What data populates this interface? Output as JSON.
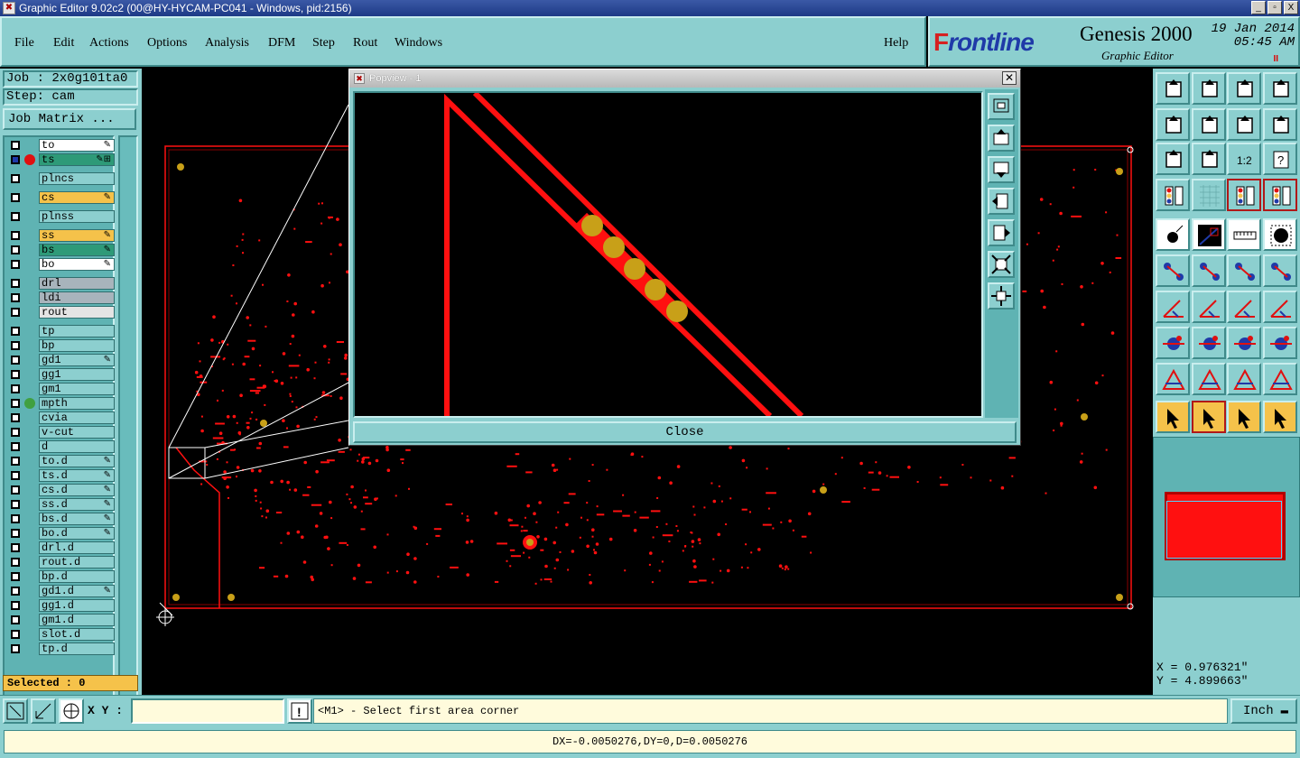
{
  "window": {
    "title": "Graphic Editor 9.02c2 (00@HY-HYCAM-PC041 - Windows, pid:2156)",
    "controls": [
      "_",
      "▫",
      "X"
    ]
  },
  "menu": {
    "items": [
      "File",
      "Edit",
      "Actions",
      "Options",
      "Analysis",
      "DFM",
      "Step",
      "Rout",
      "Windows"
    ],
    "help": "Help"
  },
  "brand": {
    "logo_prefix": "F",
    "logo": "rontline",
    "product": "Genesis 2000",
    "subtitle": "Graphic Editor",
    "date": "19 Jan 2014",
    "time": "05:45 AM",
    "pause": "II"
  },
  "job": {
    "label": "Job : 2x0g101ta0",
    "step": "Step: cam",
    "matrix_button": "Job Matrix ..."
  },
  "layers": [
    {
      "name": "to",
      "color": "#ffffff",
      "mark": "✎"
    },
    {
      "name": "ts",
      "color": "#2e9a78",
      "mark": "✎⊞",
      "work": true,
      "dot": "#e01010"
    },
    {
      "name": "plncs",
      "color": "#8ccfcf",
      "mark": ""
    },
    {
      "name": "cs",
      "color": "#f5c24a",
      "mark": "✎"
    },
    {
      "name": "plnss",
      "color": "#8ccfcf",
      "mark": ""
    },
    {
      "name": "ss",
      "color": "#f5c24a",
      "mark": "✎"
    },
    {
      "name": "bs",
      "color": "#2e9a78",
      "mark": "✎"
    },
    {
      "name": "bo",
      "color": "#ffffff",
      "mark": "✎"
    },
    {
      "name": "drl",
      "color": "#a8b4bc",
      "mark": ""
    },
    {
      "name": "ldi",
      "color": "#a8b4bc",
      "mark": ""
    },
    {
      "name": "rout",
      "color": "#e4e4e4",
      "mark": ""
    },
    {
      "name": "tp",
      "color": "#8ccfcf",
      "mark": ""
    },
    {
      "name": "bp",
      "color": "#8ccfcf",
      "mark": ""
    },
    {
      "name": "gd1",
      "color": "#8ccfcf",
      "mark": "✎"
    },
    {
      "name": "gg1",
      "color": "#8ccfcf",
      "mark": ""
    },
    {
      "name": "gm1",
      "color": "#8ccfcf",
      "mark": ""
    },
    {
      "name": "mpth",
      "color": "#8ccfcf",
      "mark": "",
      "dot": "#40a040"
    },
    {
      "name": "cvia",
      "color": "#8ccfcf",
      "mark": ""
    },
    {
      "name": "v-cut",
      "color": "#8ccfcf",
      "mark": ""
    },
    {
      "name": "d",
      "color": "#8ccfcf",
      "mark": ""
    },
    {
      "name": "to.d",
      "color": "#8ccfcf",
      "mark": "✎"
    },
    {
      "name": "ts.d",
      "color": "#8ccfcf",
      "mark": "✎"
    },
    {
      "name": "cs.d",
      "color": "#8ccfcf",
      "mark": "✎"
    },
    {
      "name": "ss.d",
      "color": "#8ccfcf",
      "mark": "✎"
    },
    {
      "name": "bs.d",
      "color": "#8ccfcf",
      "mark": "✎"
    },
    {
      "name": "bo.d",
      "color": "#8ccfcf",
      "mark": "✎"
    },
    {
      "name": "drl.d",
      "color": "#8ccfcf",
      "mark": ""
    },
    {
      "name": "rout.d",
      "color": "#8ccfcf",
      "mark": ""
    },
    {
      "name": "bp.d",
      "color": "#8ccfcf",
      "mark": ""
    },
    {
      "name": "gd1.d",
      "color": "#8ccfcf",
      "mark": "✎"
    },
    {
      "name": "gg1.d",
      "color": "#8ccfcf",
      "mark": ""
    },
    {
      "name": "gm1.d",
      "color": "#8ccfcf",
      "mark": ""
    },
    {
      "name": "slot.d",
      "color": "#8ccfcf",
      "mark": ""
    },
    {
      "name": "tp.d",
      "color": "#8ccfcf",
      "mark": ""
    }
  ],
  "selected": "Selected : 0",
  "popview": {
    "title": "Popview - 1",
    "close_label": "Close"
  },
  "coords": {
    "x": "X = 0.976321\"",
    "y": "Y = 4.899663\""
  },
  "bottom": {
    "xy_label": "X Y :",
    "xy_value": "",
    "prompt": "<M1> - Select first area corner",
    "units": "Inch"
  },
  "status": "DX=-0.0050276,DY=0,D=0.0050276",
  "colors": {
    "panel": "#8ccfcf",
    "feature": "#ff1010",
    "pad": "#c8a018",
    "selection": "#f5c24a"
  }
}
